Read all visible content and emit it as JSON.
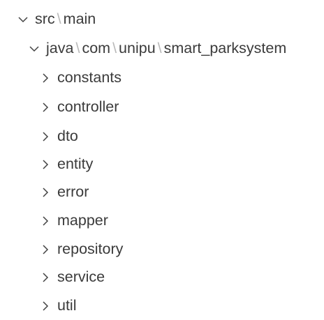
{
  "explorer": {
    "root": {
      "segments": [
        "src",
        "main"
      ],
      "separator": "\\",
      "expanded": true,
      "chevron_icon": "chevron-down-icon"
    },
    "package": {
      "segments": [
        "java",
        "com",
        "unipu",
        "smart_parksystem"
      ],
      "separator": "\\",
      "expanded": true,
      "chevron_icon": "chevron-down-icon"
    },
    "folders": [
      {
        "label": "constants",
        "expanded": false,
        "chevron_icon": "chevron-right-icon"
      },
      {
        "label": "controller",
        "expanded": false,
        "chevron_icon": "chevron-right-icon"
      },
      {
        "label": "dto",
        "expanded": false,
        "chevron_icon": "chevron-right-icon"
      },
      {
        "label": "entity",
        "expanded": false,
        "chevron_icon": "chevron-right-icon"
      },
      {
        "label": "error",
        "expanded": false,
        "chevron_icon": "chevron-right-icon"
      },
      {
        "label": "mapper",
        "expanded": false,
        "chevron_icon": "chevron-right-icon"
      },
      {
        "label": "repository",
        "expanded": false,
        "chevron_icon": "chevron-right-icon"
      },
      {
        "label": "service",
        "expanded": false,
        "chevron_icon": "chevron-right-icon"
      },
      {
        "label": "util",
        "expanded": false,
        "chevron_icon": "chevron-right-icon"
      }
    ]
  },
  "colors": {
    "text": "#3b3b3b",
    "separator": "#b9b9b9",
    "chevron": "#424242",
    "background": "#ffffff"
  }
}
